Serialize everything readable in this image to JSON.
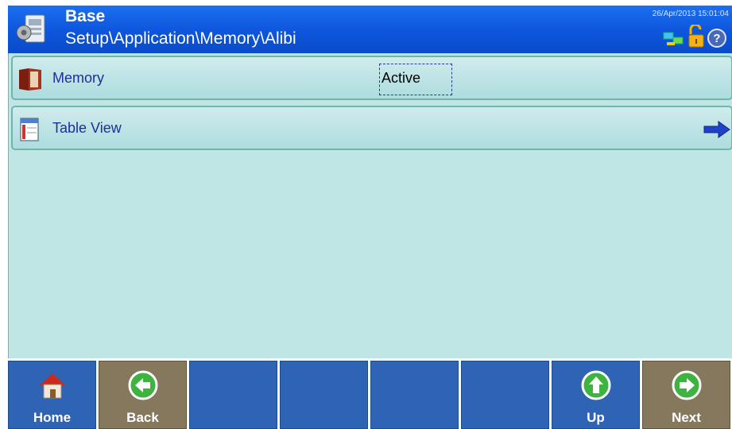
{
  "header": {
    "title": "Base",
    "path": "Setup\\Application\\Memory\\Alibi",
    "datetime": "26/Apr/2013 15:01:04",
    "icons": [
      "scale-icon",
      "network-icon",
      "unlock-icon",
      "help-icon"
    ]
  },
  "rows": [
    {
      "label": "Memory",
      "value": "Active",
      "icon": "book-icon"
    },
    {
      "label": "Table View",
      "icon": "table-icon",
      "action_icon": "arrow-right-icon"
    }
  ],
  "softkeys": [
    {
      "label": "Home",
      "icon": "home-icon"
    },
    {
      "label": "Back",
      "icon": "back-arrow-icon"
    },
    {
      "label": ""
    },
    {
      "label": ""
    },
    {
      "label": ""
    },
    {
      "label": ""
    },
    {
      "label": "Up",
      "icon": "up-arrow-icon"
    },
    {
      "label": "Next",
      "icon": "next-arrow-icon"
    }
  ],
  "colors": {
    "header": "#0d55dc",
    "content_bg": "#bfe6e5",
    "softkey_blue": "#2f64b5",
    "softkey_tan": "#86785d"
  }
}
